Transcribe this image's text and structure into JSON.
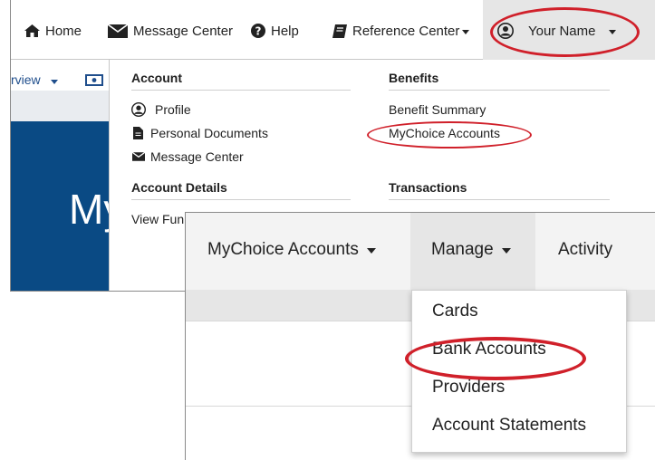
{
  "topnav": {
    "home_label": "Home",
    "message_center_label": "Message Center",
    "help_label": "Help",
    "reference_center_label": "Reference Center",
    "user_label": "Your Name",
    "icons": [
      "home-icon",
      "envelope-icon",
      "question-circle-icon",
      "book-icon",
      "user-circle-icon",
      "caret-down-icon"
    ]
  },
  "left": {
    "overview_label": "rview",
    "hero_text": "My"
  },
  "menu": {
    "account": {
      "heading": "Account",
      "items": [
        "Profile",
        "Personal Documents",
        "Message Center"
      ]
    },
    "account_details": {
      "heading": "Account Details",
      "items": [
        "View Fun"
      ]
    },
    "benefits": {
      "heading": "Benefits",
      "items": [
        "Benefit Summary",
        "MyChoice Accounts"
      ]
    },
    "transactions": {
      "heading": "Transactions"
    }
  },
  "subnav": {
    "mychoice_label": "MyChoice Accounts",
    "manage_label": "Manage",
    "activity_label": "Activity"
  },
  "manage_dropdown": {
    "items": [
      "Cards",
      "Bank Accounts",
      "Providers",
      "Account Statements"
    ]
  },
  "colors": {
    "highlight_ring": "#d0202a",
    "hero_bg": "#0a4a84",
    "link_blue": "#1f4e8c",
    "selected_bg": "#e6e6e6"
  }
}
